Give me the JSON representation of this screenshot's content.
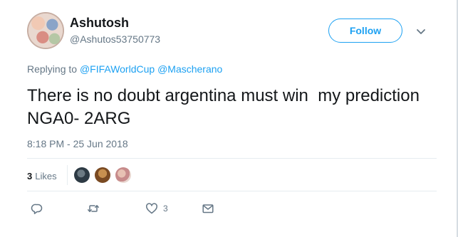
{
  "user": {
    "name": "Ashutosh",
    "handle": "@Ashutos53750773"
  },
  "follow_label": "Follow",
  "reply_context": {
    "prefix": "Replying to",
    "mentions": [
      "@FIFAWorldCup",
      "@Mascherano"
    ]
  },
  "tweet": {
    "text": "There is no doubt argentina must win  my prediction NGA0- 2ARG",
    "timestamp": "8:18 PM - 25 Jun 2018"
  },
  "stats": {
    "likes_count": "3",
    "likes_label": "Likes"
  },
  "actions": {
    "like_count": "3"
  },
  "icons": {
    "reply": "reply-icon",
    "retweet": "retweet-icon",
    "like": "heart-icon",
    "message": "envelope-icon",
    "more": "chevron-down-icon"
  },
  "colors": {
    "accent": "#1da1f2",
    "text": "#14171a",
    "muted": "#657786",
    "divider": "#e6ecf0"
  }
}
